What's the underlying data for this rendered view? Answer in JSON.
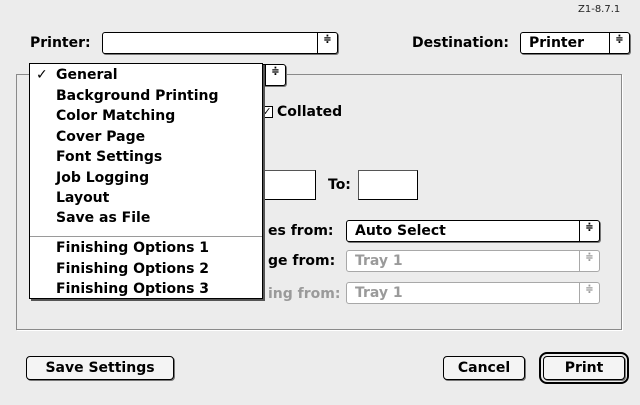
{
  "version": "Z1-8.7.1",
  "printer": {
    "label": "Printer:",
    "value": ""
  },
  "destination": {
    "label": "Destination:",
    "value": "Printer"
  },
  "arrows": "≑",
  "copies": {
    "collated_label": "Collated",
    "check": "✓"
  },
  "pages": {
    "to_label": "To:"
  },
  "paper_source": {
    "first": {
      "label": "es from:",
      "value": "Auto Select"
    },
    "remaining": {
      "label": "ge from:",
      "value": "Tray 1"
    },
    "third": {
      "label": "ing from:",
      "value": "Tray 1"
    }
  },
  "menu": {
    "check": "✓",
    "items": [
      "General",
      "Background Printing",
      "Color Matching",
      "Cover Page",
      "Font Settings",
      "Job Logging",
      "Layout",
      "Save as File",
      "Finishing Options 1",
      "Finishing Options 2",
      "Finishing Options 3"
    ]
  },
  "buttons": {
    "save": "Save Settings",
    "cancel": "Cancel",
    "print": "Print"
  }
}
